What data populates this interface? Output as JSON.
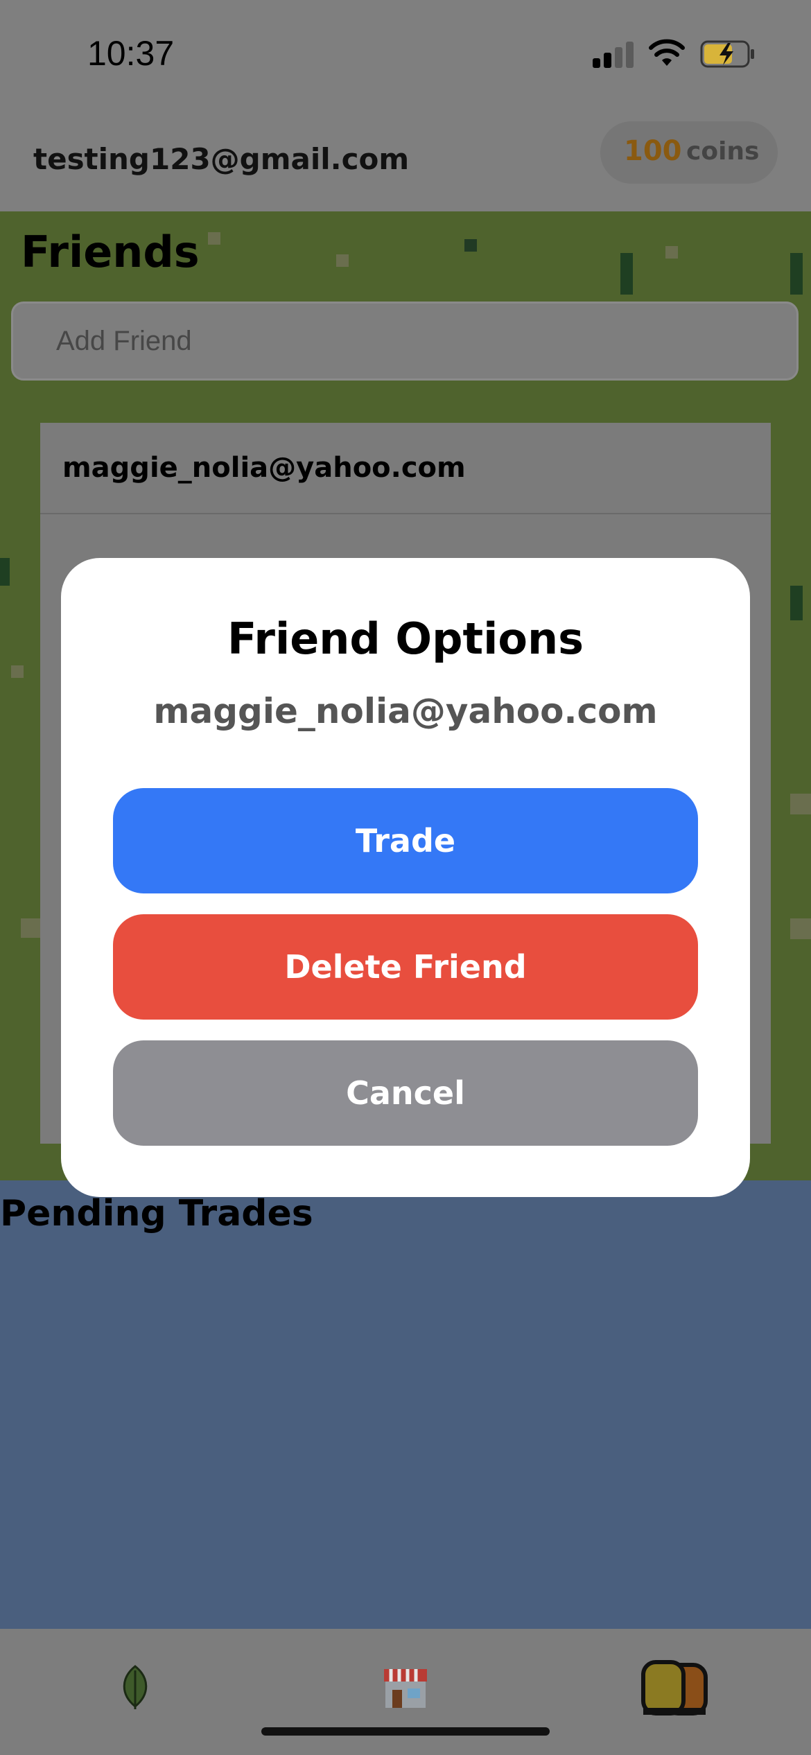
{
  "status_bar": {
    "time": "10:37"
  },
  "header": {
    "user_email": "testing123@gmail.com",
    "coins_amount": "100",
    "coins_label": "coins"
  },
  "friends": {
    "title": "Friends",
    "add_friend_placeholder": "Add Friend",
    "list": [
      {
        "email": "maggie_nolia@yahoo.com"
      }
    ]
  },
  "pending_trades": {
    "title": "Pending Trades"
  },
  "modal": {
    "title": "Friend Options",
    "subtitle": "maggie_nolia@yahoo.com",
    "trade_label": "Trade",
    "delete_label": "Delete Friend",
    "cancel_label": "Cancel"
  },
  "tab_bar": {
    "tabs": [
      {
        "icon": "leaf-icon"
      },
      {
        "icon": "shop-icon"
      },
      {
        "icon": "friends-icon"
      }
    ]
  },
  "colors": {
    "trade_button": "#3478f6",
    "delete_button": "#e84e3e",
    "cancel_button": "#8e8e93",
    "coins_accent": "#c98a17",
    "grass": "#4f632d",
    "pending_bg": "#4a5f7e"
  }
}
